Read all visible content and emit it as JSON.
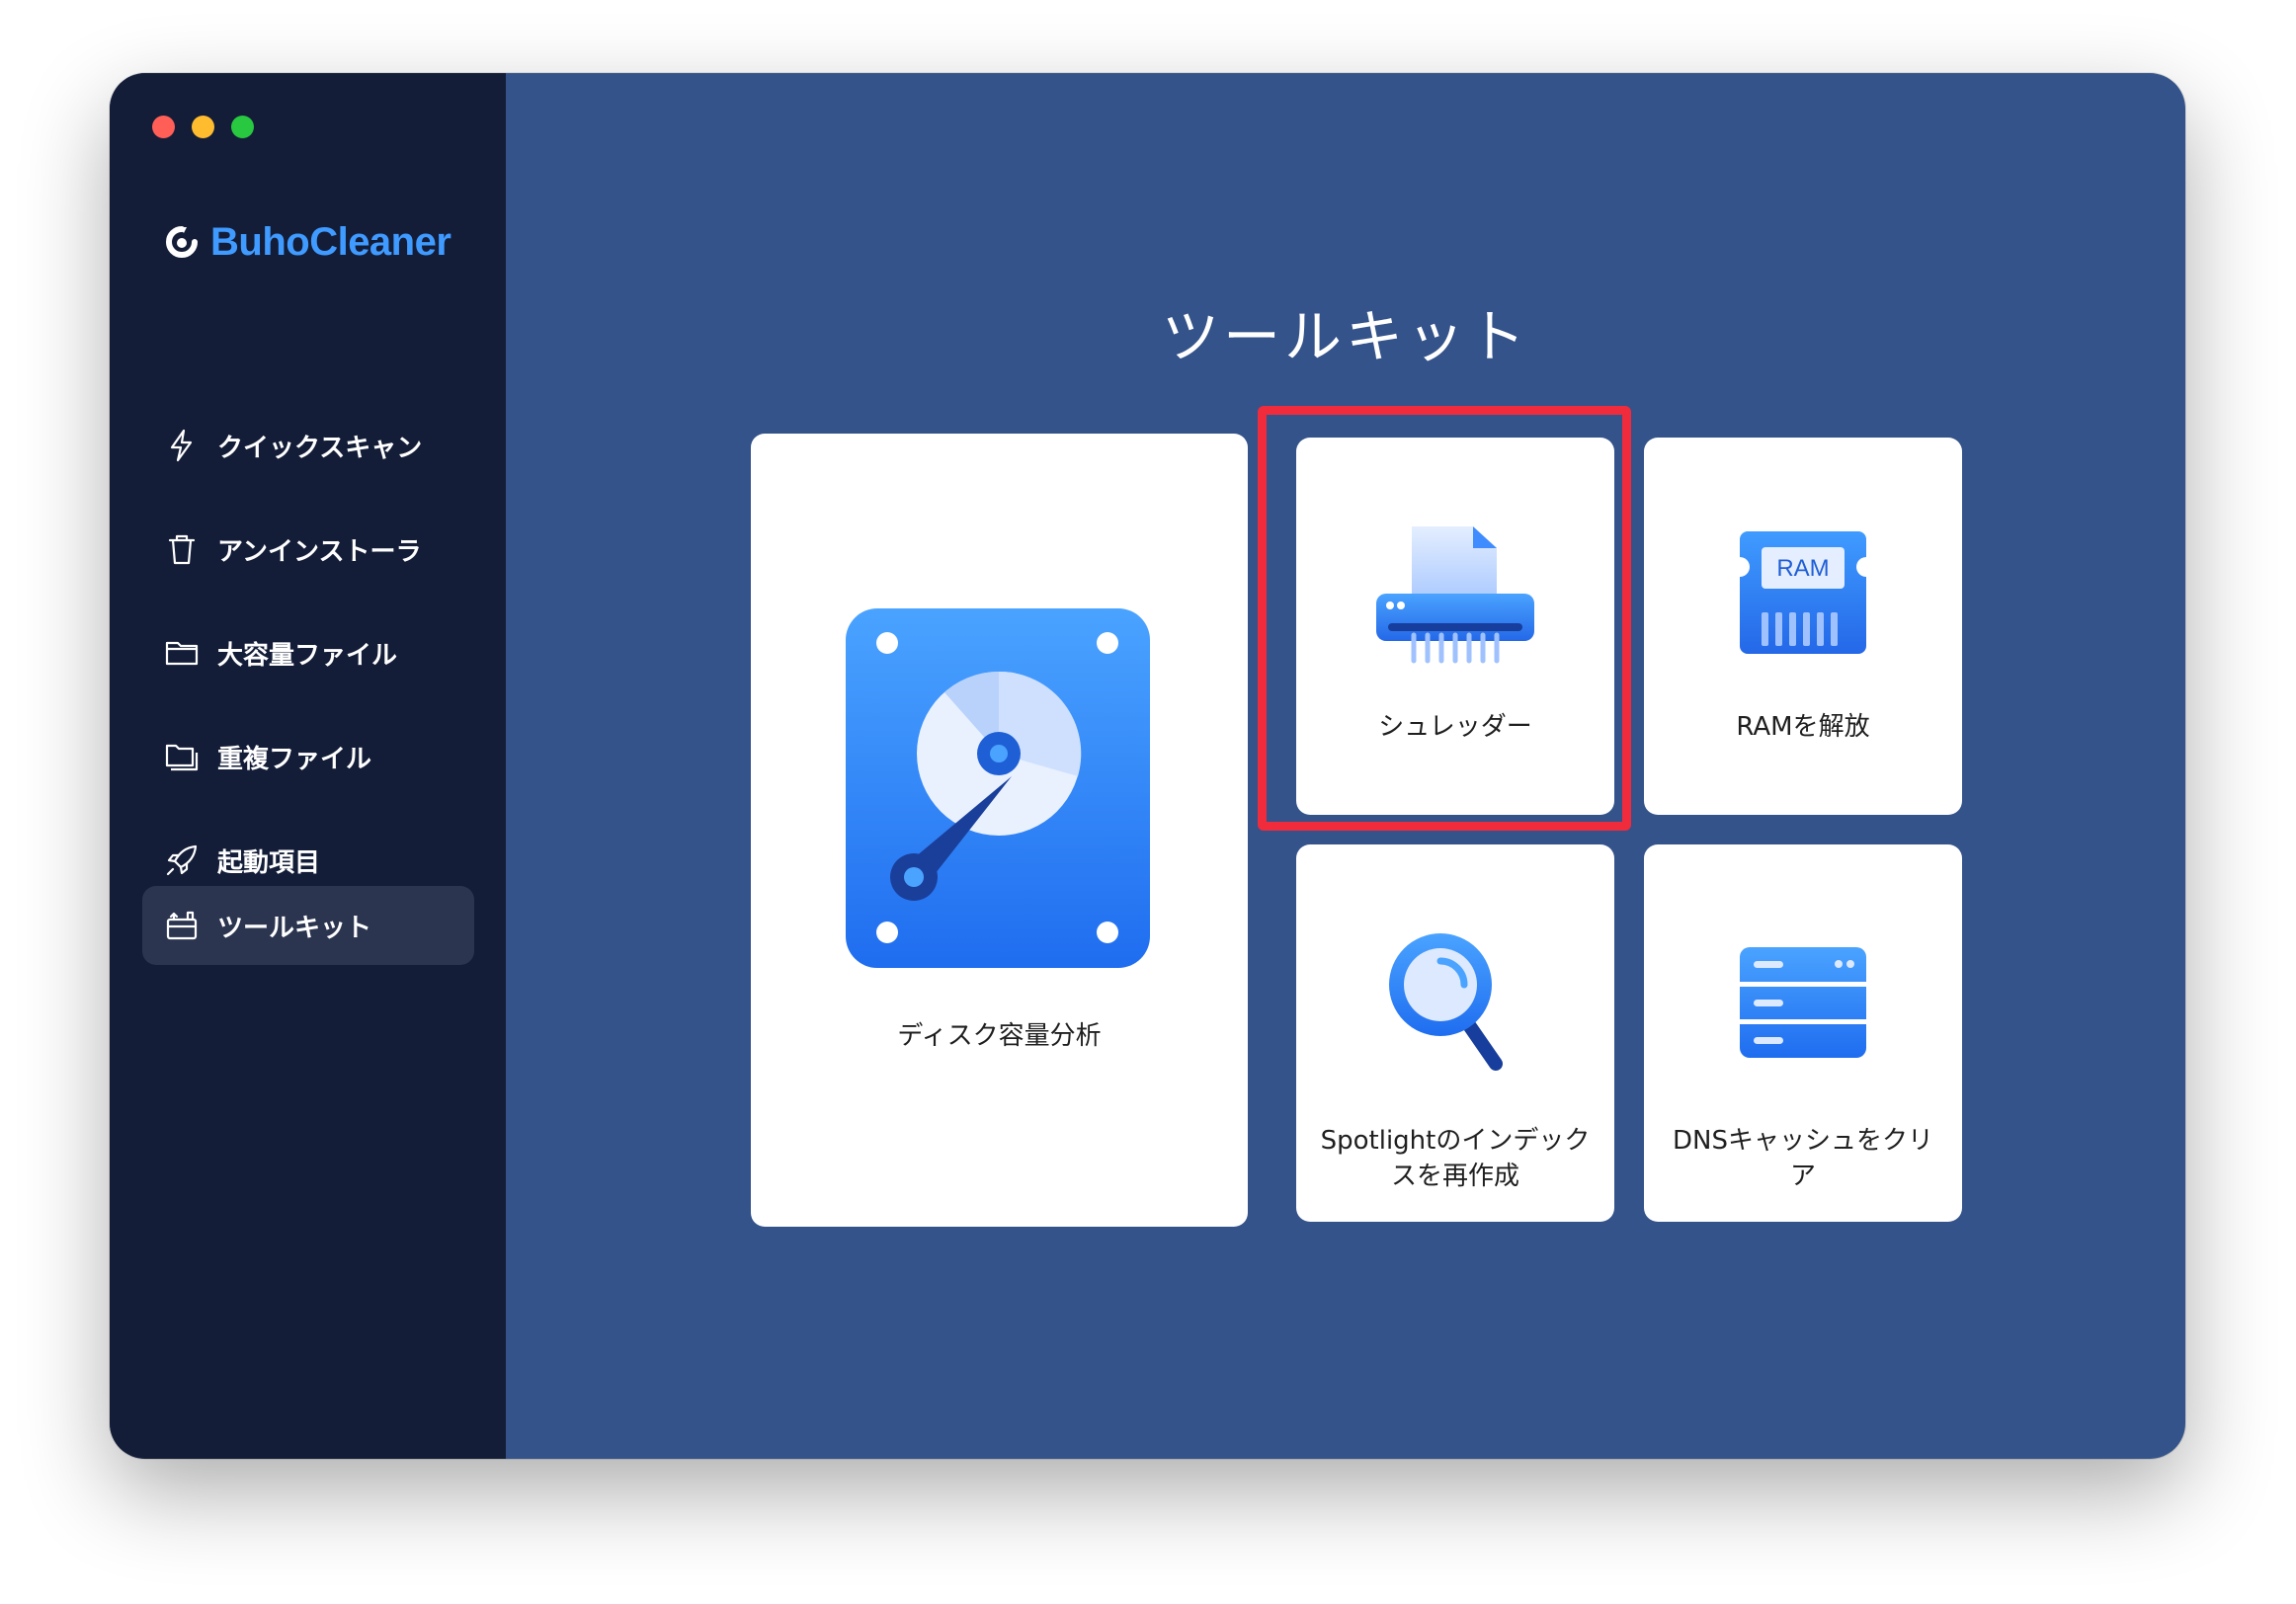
{
  "app": {
    "name": "BuhoCleaner"
  },
  "sidebar": {
    "items": [
      {
        "label": "クイックスキャン",
        "icon": "bolt-icon"
      },
      {
        "label": "アンインストーラ",
        "icon": "trash-icon"
      },
      {
        "label": "大容量ファイル",
        "icon": "folder-icon"
      },
      {
        "label": "重複ファイル",
        "icon": "duplicate-folder-icon"
      },
      {
        "label": "起動項目",
        "icon": "rocket-icon"
      },
      {
        "label": "ツールキット",
        "icon": "toolbox-icon",
        "active": true
      }
    ]
  },
  "main": {
    "title": "ツールキット",
    "tools": [
      {
        "label": "ディスク容量分析",
        "icon": "disk-analyzer-icon"
      },
      {
        "label": "シュレッダー",
        "icon": "shredder-icon",
        "highlighted": true
      },
      {
        "label": "RAMを解放",
        "icon": "ram-icon",
        "icon_text": "RAM"
      },
      {
        "label_line1": "Spotlightのインデック",
        "label_line2": "スを再作成",
        "icon": "magnifier-icon"
      },
      {
        "label_line1": "DNSキャッシュをクリ",
        "label_line2": "ア",
        "icon": "server-icon"
      }
    ]
  },
  "colors": {
    "sidebar_bg": "#141d38",
    "main_bg": "#34538a",
    "brand": "#3f9bff",
    "highlight": "#ef2b3c"
  }
}
